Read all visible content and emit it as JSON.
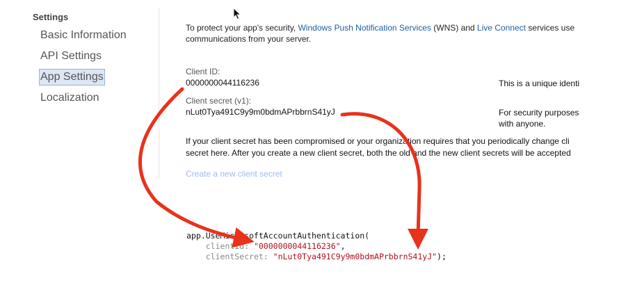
{
  "sidebar": {
    "title": "Settings",
    "items": [
      {
        "label": "Basic Information",
        "selected": false
      },
      {
        "label": "API Settings",
        "selected": false
      },
      {
        "label": "App Settings",
        "selected": true
      },
      {
        "label": "Localization",
        "selected": false
      }
    ]
  },
  "intro": {
    "part1": "To protect your app's security, ",
    "wns_link": "Windows Push Notification Services",
    "part2": " (WNS) and ",
    "live_link": "Live Connect",
    "part3": " services use",
    "line2": "communications from your server."
  },
  "client_id": {
    "label": "Client ID:",
    "value": "0000000044116236",
    "note": "This is a unique identi"
  },
  "client_secret": {
    "label": "Client secret (v1):",
    "value": "nLut0Tya491C9y9m0bdmAPrbbrnS41yJ",
    "note_line1": "For security purposes",
    "note_line2": "with anyone."
  },
  "compromise_text": {
    "line1": "If your client secret has been compromised or your organization requires that you periodically change cli",
    "line2": "secret here. After you create a new client secret, both the old and the new client secrets will be accepted"
  },
  "create_link": "Create a new client secret",
  "code": {
    "line1": "app.UseMicrosoftAccountAuthentication(",
    "id_key": "clientId: ",
    "id_value": "\"0000000044116236\"",
    "secret_key": "clientSecret: ",
    "secret_value": "\"nLut0Tya491C9y9m0bdmAPrbbrnS41yJ\"",
    "line_end": ");"
  },
  "colors": {
    "arrow": "#e8321c",
    "link": "#1d5fa5",
    "code_string": "#b0101a"
  },
  "icons": [
    "mouse-pointer-icon",
    "arrow-annotation"
  ]
}
